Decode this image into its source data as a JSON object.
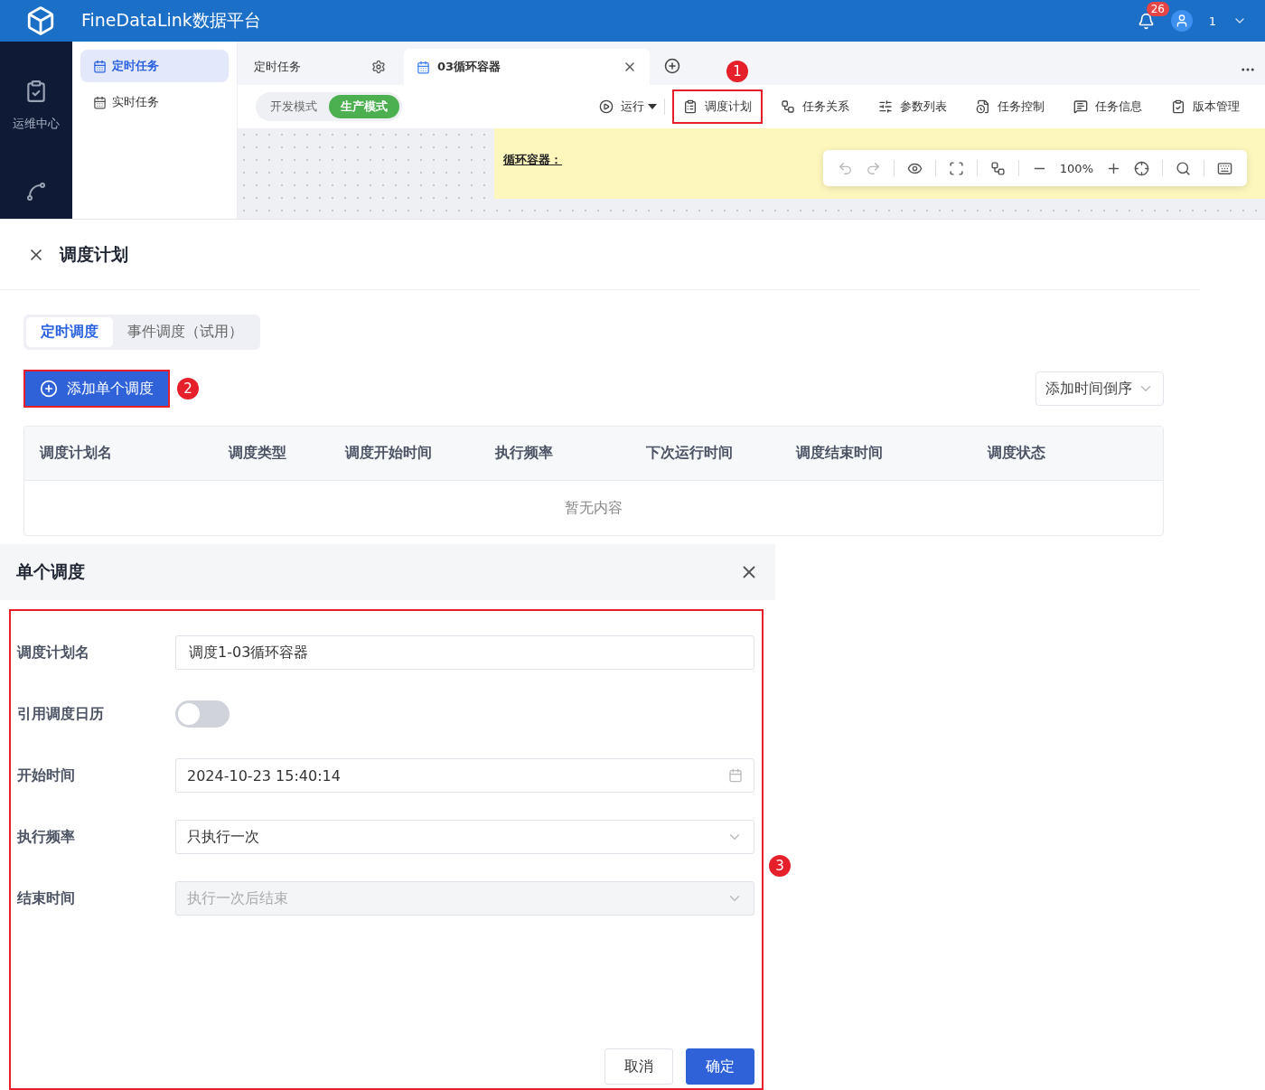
{
  "header": {
    "title": "FineDataLink数据平台",
    "notification_count": "26",
    "user": "1"
  },
  "nav_rail": {
    "items": [
      {
        "label": "运维中心",
        "selected": true
      }
    ]
  },
  "sidebar": {
    "items": [
      {
        "label": "定时任务",
        "selected": true
      },
      {
        "label": "实时任务",
        "selected": false
      }
    ]
  },
  "tabs": [
    {
      "label": "定时任务",
      "selected": false
    },
    {
      "label": "03循环容器",
      "selected": true
    }
  ],
  "mode_switch": [
    {
      "label": "开发模式",
      "selected": false
    },
    {
      "label": "生产模式",
      "selected": true
    }
  ],
  "toolbar": [
    {
      "label": "运行",
      "highlighted": false
    },
    {
      "label": "调度计划",
      "highlighted": true
    },
    {
      "label": "任务关系",
      "highlighted": false
    },
    {
      "label": "参数列表",
      "highlighted": false
    },
    {
      "label": "任务控制",
      "highlighted": false
    },
    {
      "label": "任务信息",
      "highlighted": false
    },
    {
      "label": "版本管理",
      "highlighted": false
    }
  ],
  "canvas": {
    "note_title": "循环容器：",
    "zoom": "100%"
  },
  "schedule_panel": {
    "title": "调度计划",
    "tabs": [
      {
        "label": "定时调度",
        "selected": true
      },
      {
        "label": "事件调度（试用）",
        "selected": false
      }
    ],
    "add_button": {
      "label": "添加单个调度",
      "highlighted": true
    },
    "sort": "添加时间倒序",
    "columns": [
      "调度计划名",
      "调度类型",
      "调度开始时间",
      "执行频率",
      "下次运行时间",
      "调度结束时间",
      "调度状态"
    ],
    "empty": "暂无内容"
  },
  "dialog": {
    "title": "单个调度",
    "highlighted": true,
    "fields": [
      {
        "kind": "text",
        "label": "调度计划名",
        "value": "调度1-03循环容器"
      },
      {
        "kind": "switch",
        "label": "引用调度日历",
        "on": false
      },
      {
        "kind": "date",
        "label": "开始时间",
        "value": "2024-10-23 15:40:14"
      },
      {
        "kind": "select",
        "label": "执行频率",
        "value": "只执行一次",
        "disabled": false
      },
      {
        "kind": "select",
        "label": "结束时间",
        "value": "执行一次后结束",
        "disabled": true
      }
    ],
    "buttons": [
      {
        "label": "取消",
        "primary": false
      },
      {
        "label": "确定",
        "primary": true
      }
    ]
  },
  "annotations": [
    "1",
    "2",
    "3"
  ]
}
